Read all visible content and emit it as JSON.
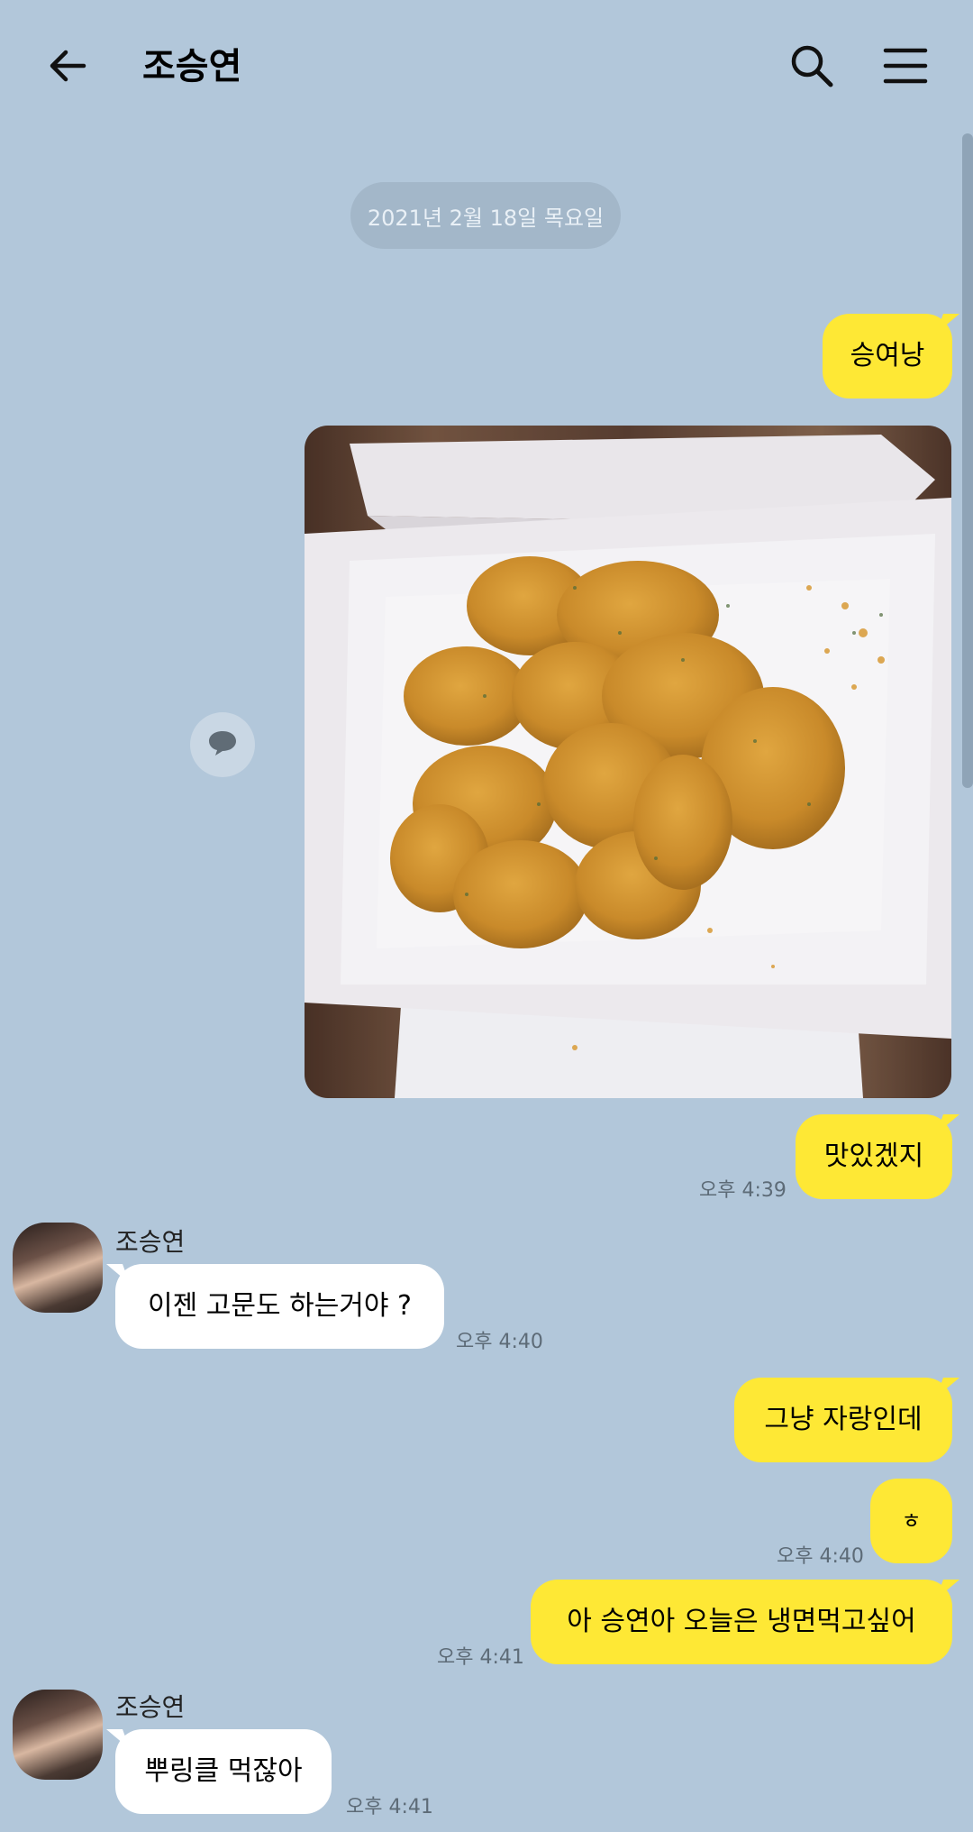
{
  "header": {
    "title": "조승연",
    "back_icon": "arrow-left-icon",
    "search_icon": "search-icon",
    "menu_icon": "hamburger-menu-icon"
  },
  "date_divider": "2021년 2월 18일 목요일",
  "colors": {
    "background": "#b2c7da",
    "my_bubble": "#fee835",
    "other_bubble": "#ffffff"
  },
  "messages": [
    {
      "from": "me",
      "text": "승여낭"
    },
    {
      "from": "me",
      "type": "photo"
    },
    {
      "from": "me",
      "text": "맛있겠지",
      "time": "오후 4:39"
    },
    {
      "from": "other",
      "sender": "조승연",
      "text": "이젠 고문도 하는거야 ?",
      "time": "오후 4:40"
    },
    {
      "from": "me",
      "text": "그냥 자랑인데"
    },
    {
      "from": "me",
      "text": "ㅎ",
      "time": "오후 4:40"
    },
    {
      "from": "me",
      "text": "아 승연아 오늘은 냉면먹고싶어",
      "time": "오후 4:41"
    },
    {
      "from": "other",
      "sender": "조승연",
      "text": "뿌링클 먹잖아",
      "time": "오후 4:41"
    }
  ]
}
